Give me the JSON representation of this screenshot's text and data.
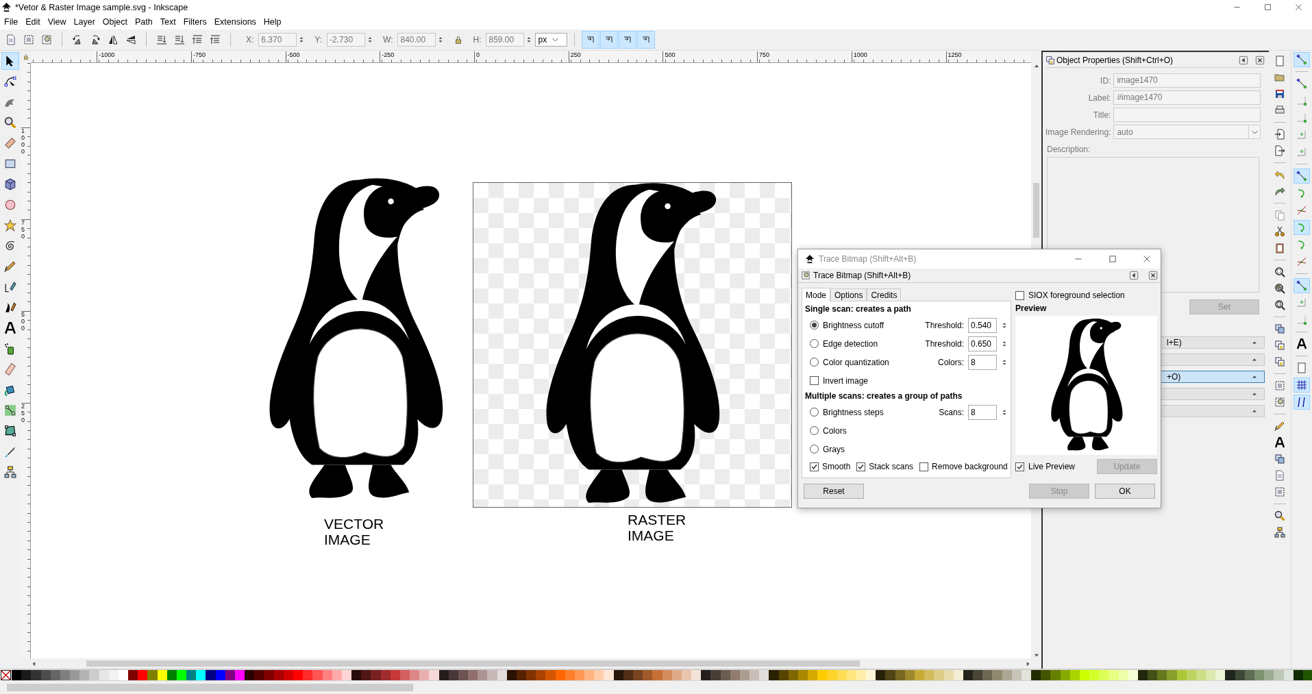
{
  "window": {
    "title": "*Vetor & Raster Image sample.svg - Inkscape"
  },
  "menu": [
    "File",
    "Edit",
    "View",
    "Layer",
    "Object",
    "Path",
    "Text",
    "Filters",
    "Extensions",
    "Help"
  ],
  "toolbar": {
    "fields": [
      {
        "label": "X:",
        "value": "6.370"
      },
      {
        "label": "Y:",
        "value": "-2.730"
      },
      {
        "label": "W:",
        "value": "840.00"
      },
      {
        "label": "H:",
        "value": "859.00"
      }
    ],
    "unit": "px",
    "toggles": [
      {
        "on": true
      },
      {
        "on": true
      },
      {
        "on": true
      },
      {
        "on": true
      }
    ]
  },
  "tools": [
    {
      "selected": true
    },
    {
      "selected": false
    },
    {
      "selected": false
    },
    {
      "selected": false
    },
    {
      "selected": false
    },
    {
      "selected": false
    },
    {
      "selected": false
    },
    {
      "selected": false
    },
    {
      "selected": false
    },
    {
      "selected": false
    },
    {
      "selected": false
    },
    {
      "selected": false
    },
    {
      "selected": false
    },
    {
      "selected": false
    },
    {
      "selected": false
    },
    {
      "selected": false
    },
    {
      "selected": false
    },
    {
      "selected": false
    },
    {
      "selected": false
    },
    {
      "selected": false
    },
    {
      "selected": false
    }
  ],
  "rulers": {
    "horizontal": [
      "-1000",
      "-750",
      "-500",
      "-250",
      "0",
      "250",
      "500",
      "750",
      "1000",
      "1250"
    ],
    "vertical": [
      "1000",
      "750",
      "500",
      "250"
    ]
  },
  "objects": [
    {
      "kind": "vector",
      "caption": "VECTOR IMAGE"
    },
    {
      "kind": "raster",
      "caption": "RASTER IMAGE"
    }
  ],
  "properties_panel": {
    "title": "Object Properties (Shift+Ctrl+O)",
    "fields": [
      {
        "label": "ID:",
        "value": "image1470"
      },
      {
        "label": "Label:",
        "value": "#image1470"
      },
      {
        "label": "Title:"
      }
    ],
    "rendering": {
      "label": "Image Rendering:",
      "value": "auto"
    },
    "description_label": "Description:",
    "set_button": {
      "label": "Set",
      "disabled": true
    },
    "docked_bars": [
      {
        "text": "l+E)",
        "selected": false
      },
      {
        "selected": false
      },
      {
        "text": "+O)",
        "selected": true
      },
      {
        "selected": false
      },
      {
        "selected": false
      }
    ]
  },
  "trace_dialog": {
    "window_title": "Trace Bitmap (Shift+Alt+B)",
    "title": "Trace Bitmap (Shift+Alt+B)",
    "tabs": [
      {
        "label": "Mode",
        "selected": true
      },
      {
        "label": "Options",
        "selected": false
      },
      {
        "label": "Credits",
        "selected": false
      }
    ],
    "sections": [
      {
        "heading": "Single scan: creates a path",
        "rows": [
          {
            "kind": "radio",
            "label": "Brightness cutoff",
            "selected": true,
            "param": {
              "label": "Threshold:",
              "value": "0.540"
            }
          },
          {
            "kind": "radio",
            "label": "Edge detection",
            "selected": false,
            "param": {
              "label": "Threshold:",
              "value": "0.650"
            }
          },
          {
            "kind": "radio",
            "label": "Color quantization",
            "selected": false,
            "param": {
              "label": "Colors:",
              "value": "8"
            }
          },
          {
            "kind": "checkbox",
            "label": "Invert image",
            "checked": false
          }
        ]
      },
      {
        "heading": "Multiple scans: creates a group of paths",
        "rows": [
          {
            "kind": "radio",
            "label": "Brightness steps",
            "selected": false,
            "param": {
              "label": "Scans:",
              "value": "8"
            }
          },
          {
            "kind": "radio",
            "label": "Colors",
            "selected": false
          },
          {
            "kind": "radio",
            "label": "Grays",
            "selected": false
          },
          {
            "kind": "checks",
            "items": [
              {
                "label": "Smooth",
                "checked": true
              },
              {
                "label": "Stack scans",
                "checked": true
              },
              {
                "label": "Remove background",
                "checked": false
              }
            ]
          }
        ]
      }
    ],
    "siox": {
      "label": "SIOX foreground selection",
      "checked": false
    },
    "preview_label": "Preview",
    "live_preview": {
      "label": "Live Preview",
      "checked": true
    },
    "update_button": {
      "label": "Update",
      "disabled": true
    },
    "buttons": [
      {
        "label": "Reset",
        "disabled": false
      },
      {
        "label": "Stop",
        "disabled": true
      },
      {
        "label": "OK",
        "disabled": false
      }
    ]
  },
  "snap_toggles": [
    {
      "on": true
    },
    {
      "on": false
    },
    {
      "on": false
    },
    {
      "on": false
    },
    {
      "on": false
    },
    {
      "on": false
    },
    {
      "on": true
    },
    {
      "on": false
    },
    {
      "on": false
    },
    {
      "on": true
    },
    {
      "on": false
    },
    {
      "on": false
    },
    {
      "on": true
    },
    {
      "on": false
    },
    {
      "on": false
    },
    {
      "on": false
    },
    {
      "on": false
    },
    {
      "on": true
    },
    {
      "on": true
    }
  ],
  "palette": [
    {
      "color": "#000000"
    },
    {
      "color": "#1a1a1a"
    },
    {
      "color": "#333333"
    },
    {
      "color": "#4d4d4d"
    },
    {
      "color": "#666666"
    },
    {
      "color": "#808080"
    },
    {
      "color": "#999999"
    },
    {
      "color": "#b3b3b3"
    },
    {
      "color": "#cccccc"
    },
    {
      "color": "#e6e6e6"
    },
    {
      "color": "#f2f2f2"
    },
    {
      "color": "#ffffff"
    },
    {
      "color": "#800000"
    },
    {
      "color": "#ff0000"
    },
    {
      "color": "#808000"
    },
    {
      "color": "#ffff00"
    },
    {
      "color": "#008000"
    },
    {
      "color": "#00ff00"
    },
    {
      "color": "#008080"
    },
    {
      "color": "#00ffff"
    },
    {
      "color": "#000080"
    },
    {
      "color": "#0000ff"
    },
    {
      "color": "#800080"
    },
    {
      "color": "#ff00ff"
    },
    {
      "color": "#2b0000"
    },
    {
      "color": "#550000"
    },
    {
      "color": "#800001"
    },
    {
      "color": "#aa0000"
    },
    {
      "color": "#d40000"
    },
    {
      "color": "#ff0001"
    },
    {
      "color": "#ff2a2a"
    },
    {
      "color": "#ff5555"
    },
    {
      "color": "#ff8080"
    },
    {
      "color": "#ffaaaa"
    },
    {
      "color": "#ffd5d5"
    },
    {
      "color": "#280b0b"
    },
    {
      "color": "#501616"
    },
    {
      "color": "#782121"
    },
    {
      "color": "#a02c2c"
    },
    {
      "color": "#c83737"
    },
    {
      "color": "#d35f5f"
    },
    {
      "color": "#de8787"
    },
    {
      "color": "#e9afaf"
    },
    {
      "color": "#f4d7d7"
    },
    {
      "color": "#241c1c"
    },
    {
      "color": "#483737"
    },
    {
      "color": "#6c5353"
    },
    {
      "color": "#916f6f"
    },
    {
      "color": "#ac9393"
    },
    {
      "color": "#c8b7b7"
    },
    {
      "color": "#e3dbdb"
    },
    {
      "color": "#2b1100"
    },
    {
      "color": "#552200"
    },
    {
      "color": "#803300"
    },
    {
      "color": "#aa4400"
    },
    {
      "color": "#d45500"
    },
    {
      "color": "#ff6600"
    },
    {
      "color": "#ff7f2a"
    },
    {
      "color": "#ff9955"
    },
    {
      "color": "#ffb380"
    },
    {
      "color": "#ffccaa"
    },
    {
      "color": "#ffe6d5"
    },
    {
      "color": "#28170b"
    },
    {
      "color": "#502d16"
    },
    {
      "color": "#784421"
    },
    {
      "color": "#a05a2c"
    },
    {
      "color": "#c87137"
    },
    {
      "color": "#d38d5f"
    },
    {
      "color": "#deaa87"
    },
    {
      "color": "#e9c6af"
    },
    {
      "color": "#f4e3d7"
    },
    {
      "color": "#241f1c"
    },
    {
      "color": "#483e37"
    },
    {
      "color": "#6c5d53"
    },
    {
      "color": "#917c6f"
    },
    {
      "color": "#ac9d93"
    },
    {
      "color": "#c8beb7"
    },
    {
      "color": "#e3dedb"
    },
    {
      "color": "#2b2200"
    },
    {
      "color": "#554400"
    },
    {
      "color": "#806600"
    },
    {
      "color": "#aa8800"
    },
    {
      "color": "#d4aa00"
    },
    {
      "color": "#ffcc00"
    },
    {
      "color": "#ffd42a"
    },
    {
      "color": "#ffdd55"
    },
    {
      "color": "#ffe680"
    },
    {
      "color": "#ffeeaa"
    },
    {
      "color": "#fff6d5"
    },
    {
      "color": "#28220b"
    },
    {
      "color": "#504416"
    },
    {
      "color": "#786721"
    },
    {
      "color": "#a0892c"
    },
    {
      "color": "#c8ab37"
    },
    {
      "color": "#d3bc5f"
    },
    {
      "color": "#decd87"
    },
    {
      "color": "#e9ddaf"
    },
    {
      "color": "#f4eed7"
    },
    {
      "color": "#24221c"
    },
    {
      "color": "#484537"
    },
    {
      "color": "#6c6753"
    },
    {
      "color": "#918a6f"
    },
    {
      "color": "#aca793"
    },
    {
      "color": "#c8c4b7"
    },
    {
      "color": "#e3e2db"
    },
    {
      "color": "#222b00"
    },
    {
      "color": "#445500"
    },
    {
      "color": "#668000"
    },
    {
      "color": "#88aa00"
    },
    {
      "color": "#aad400"
    },
    {
      "color": "#ccff00"
    },
    {
      "color": "#d4ff2a"
    },
    {
      "color": "#ddff55"
    },
    {
      "color": "#e5ff80"
    },
    {
      "color": "#eeffaa"
    },
    {
      "color": "#f6ffd5"
    },
    {
      "color": "#22280b"
    },
    {
      "color": "#445016"
    },
    {
      "color": "#677821"
    },
    {
      "color": "#89a02c"
    },
    {
      "color": "#abc837"
    },
    {
      "color": "#bcd35f"
    },
    {
      "color": "#cdde87"
    },
    {
      "color": "#dde9af"
    },
    {
      "color": "#eef4d7"
    },
    {
      "color": "#1f241c"
    },
    {
      "color": "#3e4837"
    },
    {
      "color": "#5d6c53"
    },
    {
      "color": "#7c916f"
    },
    {
      "color": "#9dac93"
    },
    {
      "color": "#bec8b7"
    },
    {
      "color": "#dee3db"
    },
    {
      "color": "#112b00"
    },
    {
      "color": "#225500"
    }
  ]
}
